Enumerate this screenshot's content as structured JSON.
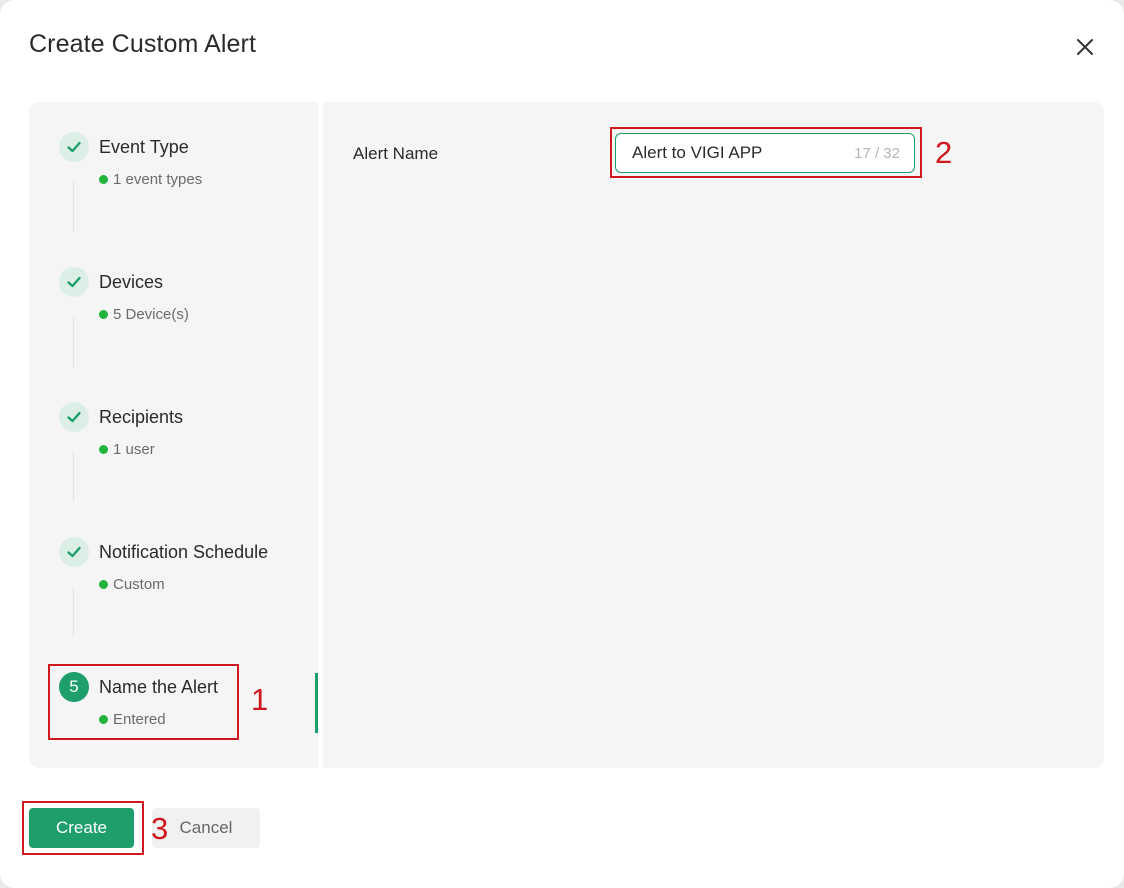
{
  "dialog": {
    "title": "Create Custom Alert",
    "close_icon": "close-icon"
  },
  "steps": [
    {
      "title": "Event Type",
      "status": "1 event types",
      "state": "done",
      "icon": "check-icon"
    },
    {
      "title": "Devices",
      "status": "5 Device(s)",
      "state": "done",
      "icon": "check-icon"
    },
    {
      "title": "Recipients",
      "status": "1 user",
      "state": "done",
      "icon": "check-icon"
    },
    {
      "title": "Notification Schedule",
      "status": "Custom",
      "state": "done",
      "icon": "check-icon"
    },
    {
      "title": "Name the Alert",
      "status": "Entered",
      "state": "current",
      "number": "5"
    }
  ],
  "form": {
    "label": "Alert Name",
    "value": "Alert to VIGI APP",
    "counter": "17 / 32"
  },
  "footer": {
    "create_label": "Create",
    "cancel_label": "Cancel"
  },
  "callouts": [
    "1",
    "2",
    "3"
  ],
  "colors": {
    "accent": "#1e9e6a",
    "status_dot": "#22b33c",
    "callout": "#d0181f"
  }
}
